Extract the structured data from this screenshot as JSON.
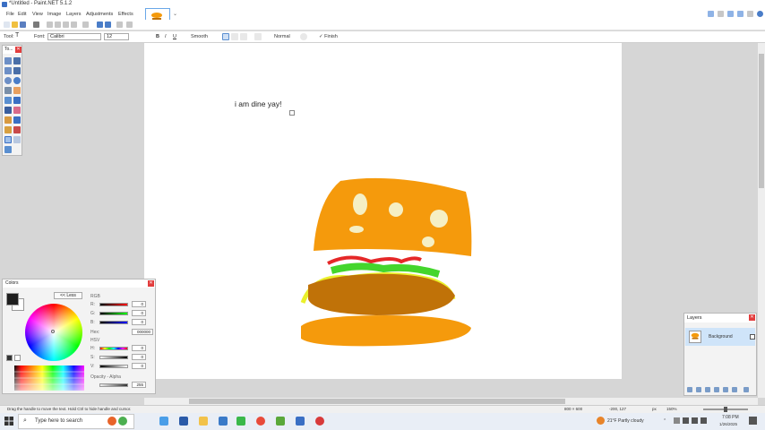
{
  "window": {
    "title": "*Untitled - Paint.NET 5.1.2",
    "controls": [
      "–",
      "▢",
      "✕"
    ]
  },
  "menu": [
    "File",
    "Edit",
    "View",
    "Image",
    "Layers",
    "Adjustments",
    "Effects"
  ],
  "toolbar_options": {
    "tool_label": "Tool:",
    "font_label": "Font:",
    "font_value": "Calibri",
    "size_value": "12",
    "bold": "B",
    "italic": "I",
    "underline": "U",
    "antialias_label": "Smooth",
    "blend_label": "Normal",
    "finish_label": "Finish"
  },
  "canvas": {
    "text": "i am dine yay!"
  },
  "tools_panel": {
    "title": "To...",
    "close": "✕"
  },
  "colors_panel": {
    "title": "Colors",
    "less_button": "<< Less",
    "rgb_label": "RGB",
    "r_label": "R:",
    "g_label": "G:",
    "b_label": "B:",
    "r_value": "0",
    "g_value": "0",
    "b_value": "0",
    "hex_label": "Hex:",
    "hex_value": "000000",
    "hsv_label": "HSV",
    "h_label": "H:",
    "s_label": "S:",
    "v_label": "V:",
    "h_value": "0",
    "s_value": "0",
    "v_value": "0",
    "opacity_label": "Opacity - Alpha",
    "opacity_value": "255",
    "close": "✕"
  },
  "layers_panel": {
    "title": "Layers",
    "layer_name": "Background",
    "close": "✕"
  },
  "status": {
    "hint": "Drag the handle to move the text. Hold Ctrl to hide handle and cursor.",
    "size": "800 × 600",
    "coords": "-200, 127",
    "units": "px",
    "zoom": "150%"
  },
  "taskbar": {
    "search_placeholder": "Type here to search",
    "weather": "21°F  Partly cloudy",
    "time": "7:08 PM",
    "date": "1/26/2025"
  },
  "colors": {
    "bun": "#f59a0c",
    "patty": "#c07208",
    "lettuce": "#44d62c",
    "ketchup": "#e52828",
    "cheese": "#eaf02a",
    "seeds": "#f5efc4",
    "accent": "#3a6fc4"
  }
}
